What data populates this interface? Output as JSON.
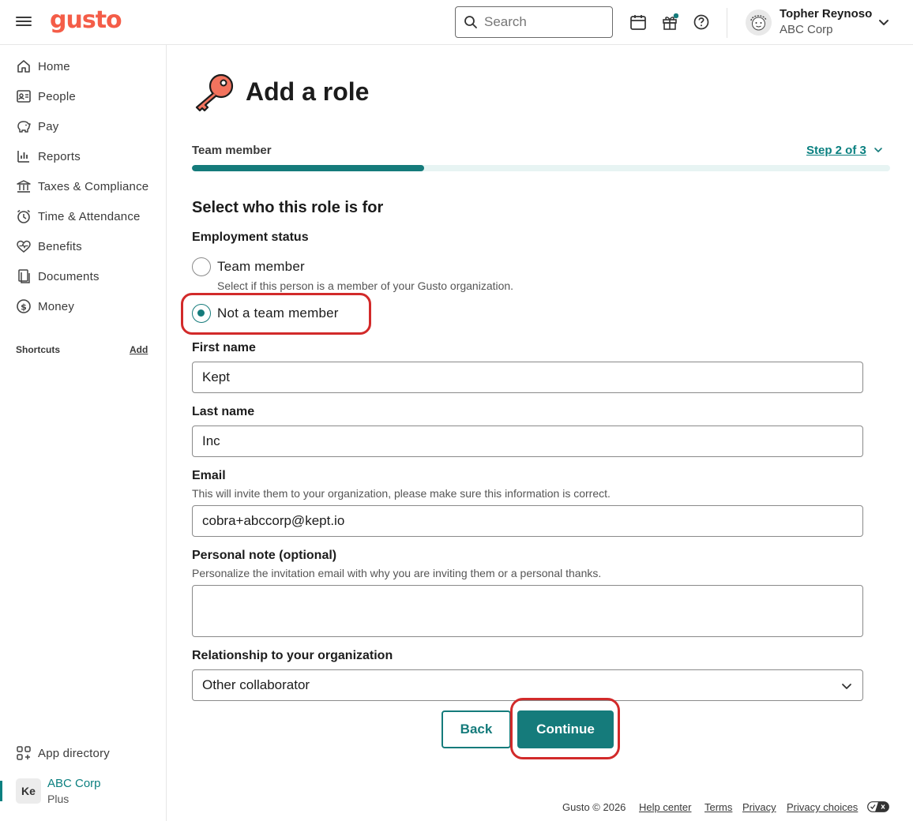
{
  "app": {
    "logo": "gusto"
  },
  "header": {
    "search_placeholder": "Search",
    "user_name": "Topher Reynoso",
    "user_company": "ABC Corp"
  },
  "sidebar": {
    "items": [
      {
        "label": "Home",
        "icon": "home-icon"
      },
      {
        "label": "People",
        "icon": "people-icon"
      },
      {
        "label": "Pay",
        "icon": "pay-icon"
      },
      {
        "label": "Reports",
        "icon": "reports-icon"
      },
      {
        "label": "Taxes & Compliance",
        "icon": "taxes-icon"
      },
      {
        "label": "Time & Attendance",
        "icon": "clock-icon"
      },
      {
        "label": "Benefits",
        "icon": "heart-icon"
      },
      {
        "label": "Documents",
        "icon": "documents-icon"
      },
      {
        "label": "Money",
        "icon": "money-icon"
      }
    ],
    "shortcuts_label": "Shortcuts",
    "shortcuts_add": "Add",
    "app_directory": "App directory",
    "company": {
      "badge": "Ke",
      "name": "ABC Corp",
      "plan": "Plus"
    }
  },
  "main": {
    "title": "Add a role",
    "step_name": "Team member",
    "step_link": "Step 2 of 3",
    "progress_fraction": 0.333,
    "section_title": "Select who this role is for",
    "employment_status_label": "Employment status",
    "options": [
      {
        "label": "Team member",
        "help": "Select if this person is a member of your Gusto organization.",
        "checked": false
      },
      {
        "label": "Not a team member",
        "checked": true
      }
    ],
    "first_name_label": "First name",
    "first_name_value": "Kept",
    "last_name_label": "Last name",
    "last_name_value": "Inc",
    "email_label": "Email",
    "email_help": "This will invite them to your organization, please make sure this information is correct.",
    "email_value": "cobra+abccorp@kept.io",
    "note_label": "Personal note (optional)",
    "note_help": "Personalize the invitation email with why you are inviting them or a personal thanks.",
    "note_value": "",
    "relationship_label": "Relationship to your organization",
    "relationship_value": "Other collaborator",
    "back_label": "Back",
    "continue_label": "Continue"
  },
  "footer": {
    "copyright": "Gusto © 2026",
    "help_center": "Help center",
    "terms": "Terms",
    "privacy": "Privacy",
    "privacy_choices": "Privacy choices"
  },
  "colors": {
    "brand": "#f45d48",
    "accent": "#157b7b",
    "highlight": "#d22a2a"
  }
}
